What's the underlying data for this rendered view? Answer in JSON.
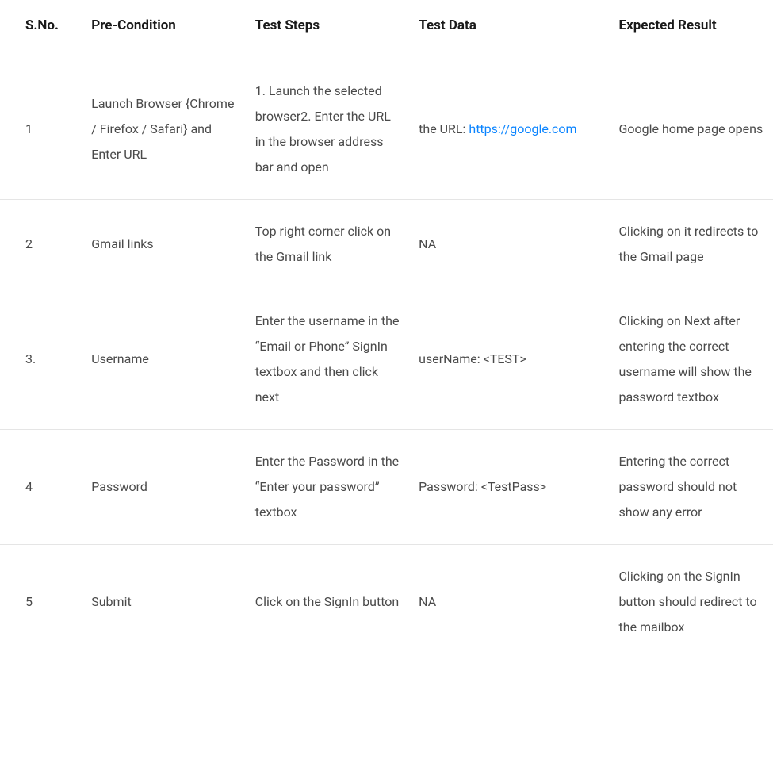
{
  "table": {
    "headers": {
      "sno": "S.No.",
      "precondition": "Pre-Condition",
      "teststeps": "Test Steps",
      "testdata": "Test Data",
      "expected": "Expected Result"
    },
    "rows": [
      {
        "sno": "1",
        "precondition": "Launch Browser {Chrome / Firefox / Safari} and Enter URL",
        "teststeps": "1. Launch the selected browser2. Enter the URL in the browser address bar and open",
        "testdata_prefix": "the URL: ",
        "testdata_link": "https://google.com",
        "expected": "Google home page opens"
      },
      {
        "sno": "2",
        "precondition": "Gmail links",
        "teststeps": "Top right corner click on the Gmail link",
        "testdata": "NA",
        "expected": "Clicking on it redirects to the Gmail page"
      },
      {
        "sno": "3.",
        "precondition": "Username",
        "teststeps": "Enter the username in the “Email or Phone” SignIn textbox and then click next",
        "testdata": "userName: <TEST>",
        "expected": "Clicking on Next after entering the correct username will show the password textbox"
      },
      {
        "sno": "4",
        "precondition": "Password",
        "teststeps": "Enter the Password in the “Enter your password” textbox",
        "testdata": "Password: <TestPass>",
        "expected": "Entering the correct password should not show any error"
      },
      {
        "sno": "5",
        "precondition": "Submit",
        "teststeps": "Click on the SignIn button",
        "testdata": "NA",
        "expected": "Clicking on the SignIn button should redirect to the mailbox"
      }
    ]
  }
}
